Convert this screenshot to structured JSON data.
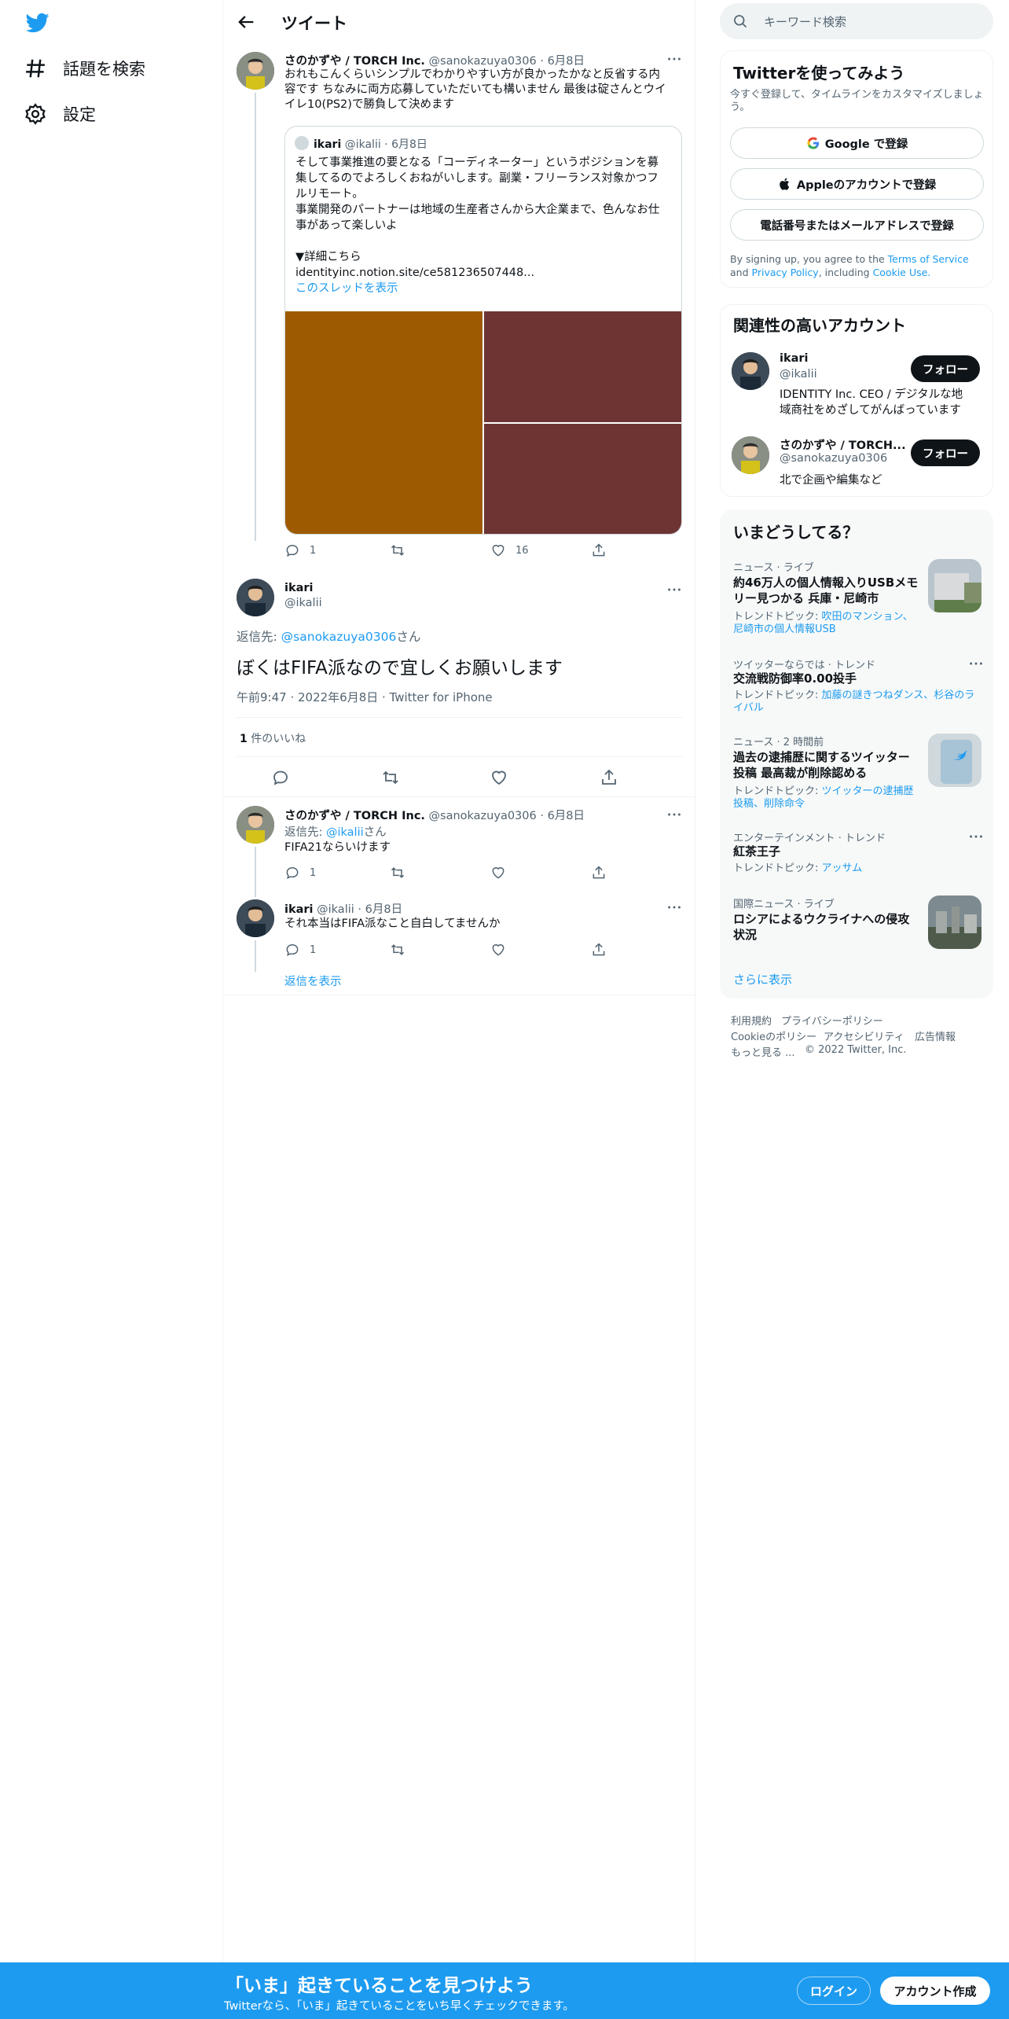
{
  "nav": {
    "explore_label": "話題を検索",
    "settings_label": "設定"
  },
  "header": {
    "title": "ツイート"
  },
  "thread": {
    "parent": {
      "name": "さのかずや / TORCH Inc.",
      "handle": "@sanokazuya0306",
      "date": "6月8日",
      "text_line1": "おれもこんくらいシンプルでわかりやすい方が良かったかなと反省する内",
      "text_line2": "容です ちなみに両方応募していただいても構いません 最後は碇さんとウイ",
      "text_line3": "イレ10(PS2)で勝負して決めます",
      "quote": {
        "name": "ikari",
        "handle": "@ikalii",
        "date": "6月8日",
        "line1": "そして事業推進の要となる「コーディネーター」というポジションを募",
        "line2": "集してるのでよろしくおねがいします。副業・フリーランス対象かつフ",
        "line3": "ルリモート。",
        "line4": "事業開発のパートナーは地域の生産者さんから大企業まで、色んなお仕",
        "line5": "事があって楽しいよ",
        "line6": "▼詳細こちら",
        "link": "identityinc.notion.site/ce581236507448...",
        "show_thread": "このスレッドを表示"
      },
      "replies": "1",
      "retweets": "",
      "likes": "16"
    },
    "focus": {
      "name": "ikari",
      "handle": "@ikalii",
      "reply_prefix": "返信先:",
      "reply_to": "@sanokazuya0306",
      "reply_suffix": "さん",
      "text": "ぼくはFIFA派なので宜しくお願いします",
      "timestamp": "午前9:47 · 2022年6月8日 · Twitter for iPhone",
      "likes_count": "1",
      "likes_label": "件のいいね"
    },
    "replies": [
      {
        "name": "さのかずや / TORCH Inc.",
        "handle": "@sanokazuya0306",
        "date": "6月8日",
        "reply_prefix": "返信先:",
        "reply_to": "@ikalii",
        "reply_suffix": "さん",
        "text": "FIFA21ならいけます",
        "replies": "1"
      },
      {
        "name": "ikari",
        "handle": "@ikalii",
        "date": "6月8日",
        "text": "それ本当はFIFA派なこと自白してませんか",
        "replies": "1"
      }
    ],
    "show_replies": "返信を表示"
  },
  "sidebar": {
    "search_placeholder": "キーワード検索",
    "signup_card": {
      "title": "Twitterを使ってみよう",
      "subtitle_line1": "今すぐ登録して、タイムラインをカスタマイズしましょ",
      "subtitle_line2": "う。",
      "google": "Google で登録",
      "apple": "Appleのアカウントで登録",
      "phone": "電話番号またはメールアドレスで登録",
      "terms_prefix": "By signing up, you agree to the",
      "terms": "Terms of Service",
      "and": "and",
      "privacy": "Privacy Policy",
      "including": ", including",
      "cookie": "Cookie Use."
    },
    "relevant": {
      "title": "関連性の高いアカウント",
      "accounts": [
        {
          "name": "ikari",
          "handle": "@ikalii",
          "bio_line1": "IDENTITY Inc. CEO / デジタルな地",
          "bio_line2": "域商社をめざしてがんばっています",
          "follow": "フォロー"
        },
        {
          "name": "さのかずや / TORCH...",
          "handle": "@sanokazuya0306",
          "bio_line1": "北で企画や編集など",
          "bio_line2": "",
          "follow": "フォロー"
        }
      ]
    },
    "trends": {
      "title": "いまどうしてる？",
      "items": [
        {
          "meta": "ニュース · ライブ",
          "title_line1": "約46万人の個人情報入りUSBメモ",
          "title_line2": "リー見つかる 兵庫・尼崎市",
          "topic_prefix": "トレンドトピック:",
          "topic_line1": "吹田のマンション、",
          "topic_line2": "尼崎市の個人情報USB"
        },
        {
          "meta": "ツイッターならでは · トレンド",
          "title_line1": "交流戦防御率0.00投手",
          "title_line2": "",
          "topic_prefix": "トレンドトピック:",
          "topic_line1": "加藤の謎きつねダンス、杉谷のラ",
          "topic_line2": "イバル"
        },
        {
          "meta": "ニュース · 2 時間前",
          "title_line1": "過去の逮捕歴に関するツイッター",
          "title_line2": "投稿 最高裁が削除認める",
          "topic_prefix": "トレンドトピック:",
          "topic_line1": "ツイッターの逮捕歴",
          "topic_line2": "投稿、削除命令"
        },
        {
          "meta": "エンターテインメント · トレンド",
          "title_line1": "紅茶王子",
          "title_line2": "",
          "topic_prefix": "トレンドトピック:",
          "topic_line1": "アッサム",
          "topic_line2": ""
        },
        {
          "meta": "国際ニュース · ライブ",
          "title_line1": "ロシアによるウクライナへの侵攻",
          "title_line2": "状況",
          "topic_prefix": "",
          "topic_line1": "",
          "topic_line2": ""
        }
      ],
      "show_more": "さらに表示"
    },
    "footer": {
      "terms": "利用規約",
      "privacy": "プライバシーポリシー",
      "cookie": "Cookieのポリシー",
      "accessibility": "アクセシビリティ",
      "ads": "広告情報",
      "more": "もっと見る ...",
      "copyright": "© 2022 Twitter, Inc."
    }
  },
  "bottom_bar": {
    "headline": "「いま」起きていることを見つけよう",
    "sub": "Twitterなら、「いま」起きていることをいち早くチェックできます。",
    "login": "ログイン",
    "signup": "アカウント作成"
  },
  "colors": {
    "brand": "#1d9bf0",
    "quote_image_left": "#9e5a00",
    "quote_image_right": "#6e3434"
  }
}
